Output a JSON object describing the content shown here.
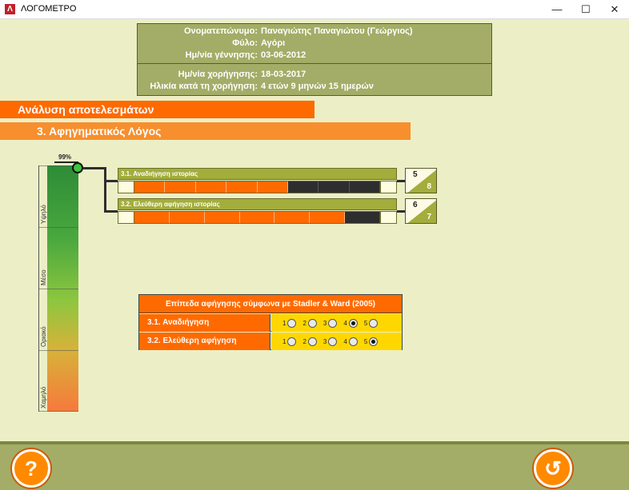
{
  "window": {
    "title": "ΛΟΓΟΜΕΤΡΟ",
    "app_icon": "Λ",
    "controls": {
      "minimize": "—",
      "maximize": "☐",
      "close": "✕"
    }
  },
  "info": {
    "name_label": "Ονοματεπώνυμο:",
    "name_value": "Παναγιώτης Παναγιώτου (Γεώργιος)",
    "gender_label": "Φύλο:",
    "gender_value": "Αγόρι",
    "birth_label": "Ημ/νία γέννησης:",
    "birth_value": "03-06-2012",
    "test_date_label": "Ημ/νία χορήγησης:",
    "test_date_value": "18-03-2017",
    "age_label": "Ηλικία κατά τη χορήγηση:",
    "age_value": "4 ετών 9 μηνών 15 ημερών"
  },
  "sections": {
    "analysis": "Ανάλυση αποτελεσμάτων",
    "narrative": "3. Αφηγηματικός Λόγος"
  },
  "gauge": {
    "percent": "99%",
    "level_labels": [
      "Υψηλό",
      "Μέσο",
      "Οριακό",
      "Χαμηλό"
    ]
  },
  "scores": [
    {
      "title": "3.1. Αναδιήγηση ιστορίας",
      "score": "5",
      "max": "8",
      "filled": 5,
      "total": 8
    },
    {
      "title": "3.2. Ελεύθερη αφήγηση ιστορίας",
      "score": "6",
      "max": "7",
      "filled": 6,
      "total": 7
    }
  ],
  "stadler": {
    "title": "Επίπεδα αφήγησης σύμφωνα με Stadler & Ward (2005)",
    "rows": [
      {
        "label": "3.1. Αναδιήγηση",
        "options": [
          "1",
          "2",
          "3",
          "4",
          "5"
        ],
        "selected": 4
      },
      {
        "label": "3.2. Ελεύθερη αφήγηση",
        "options": [
          "1",
          "2",
          "3",
          "4",
          "5"
        ],
        "selected": 5
      }
    ]
  },
  "footer": {
    "help_symbol": "?",
    "back_symbol": "↺"
  },
  "colors": {
    "background": "#ecefc6",
    "accent_orange": "#ff6a00",
    "olive": "#a3ad67",
    "radio_row": "#ffd700"
  }
}
